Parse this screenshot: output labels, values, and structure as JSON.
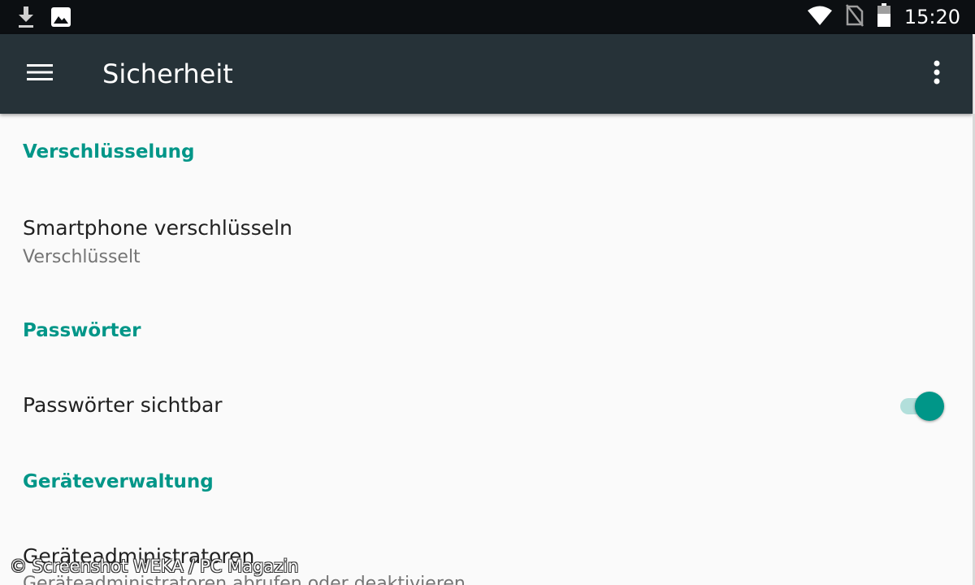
{
  "status_bar": {
    "time": "15:20",
    "icons": [
      "download-icon",
      "image-icon",
      "wifi-icon",
      "no-sim-icon",
      "battery-icon"
    ]
  },
  "app_bar": {
    "title": "Sicherheit",
    "menu_icon": "hamburger-menu-icon",
    "overflow_icon": "more-vert-icon"
  },
  "sections": {
    "encryption": {
      "header": "Verschlüsselung",
      "item_title": "Smartphone verschlüsseln",
      "item_summary": "Verschlüsselt"
    },
    "passwords": {
      "header": "Passwörter",
      "item_title": "Passwörter sichtbar",
      "toggle_on": true
    },
    "device_admin": {
      "header": "Geräteverwaltung",
      "item_title": "Geräteadministratoren",
      "item_summary": "Geräteadministratoren abrufen oder deaktivieren"
    }
  },
  "colors": {
    "accent": "#009688",
    "app_bar": "#263238",
    "status_bar": "#0c0f12",
    "background": "#fafafa"
  },
  "watermark": "© Screenshot WEKA / PC Magazin"
}
